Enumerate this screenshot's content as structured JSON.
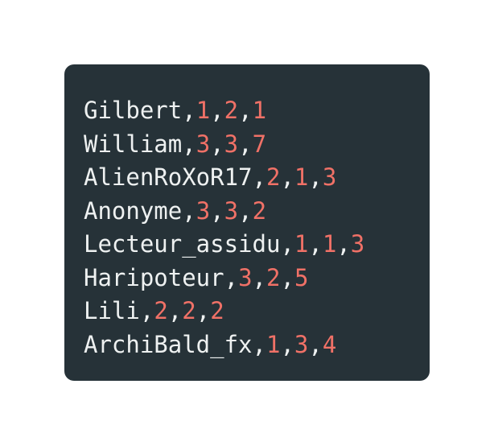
{
  "colors": {
    "background": "#ffffff",
    "code_block": "#263238",
    "text": "#eef1f1",
    "number": "#f07167"
  },
  "rows": [
    {
      "name": "Gilbert",
      "values": [
        "1",
        "2",
        "1"
      ]
    },
    {
      "name": "William",
      "values": [
        "3",
        "3",
        "7"
      ]
    },
    {
      "name": "AlienRoXoR17",
      "values": [
        "2",
        "1",
        "3"
      ]
    },
    {
      "name": "Anonyme",
      "values": [
        "3",
        "3",
        "2"
      ]
    },
    {
      "name": "Lecteur_assidu",
      "values": [
        "1",
        "1",
        "3"
      ]
    },
    {
      "name": "Haripoteur",
      "values": [
        "3",
        "2",
        "5"
      ]
    },
    {
      "name": "Lili",
      "values": [
        "2",
        "2",
        "2"
      ]
    },
    {
      "name": "ArchiBald_fx",
      "values": [
        "1",
        "3",
        "4"
      ]
    }
  ]
}
